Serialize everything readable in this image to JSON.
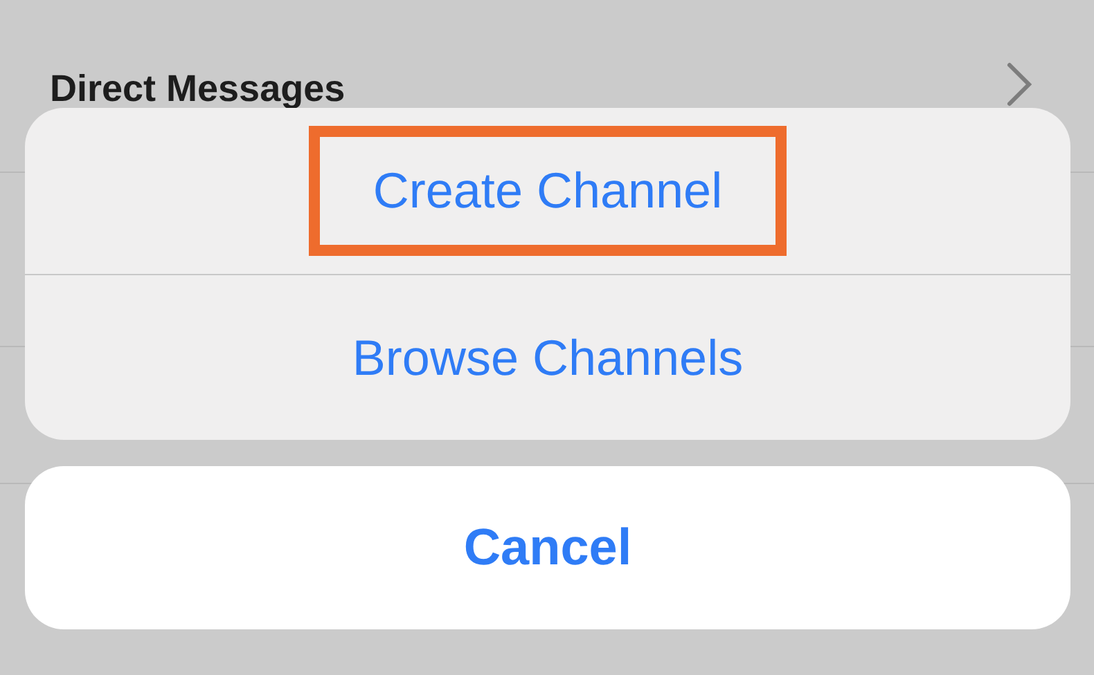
{
  "background_list": [
    {
      "label": "Direct Messages",
      "kind": "header"
    }
  ],
  "action_sheet": {
    "actions": [
      {
        "label": "Create Channel",
        "highlighted": true
      },
      {
        "label": "Browse Channels",
        "highlighted": false
      }
    ],
    "cancel": "Cancel"
  }
}
